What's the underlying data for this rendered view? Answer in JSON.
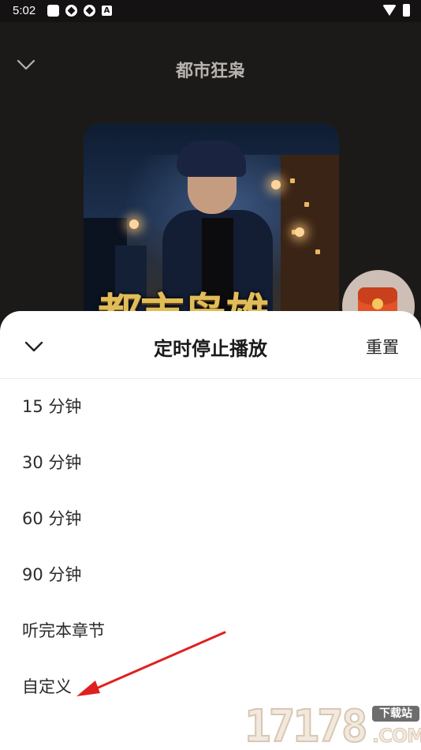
{
  "status_bar": {
    "time": "5:02",
    "left_icons": [
      "app-square-icon",
      "aperture-icon",
      "aperture-icon",
      "a-badge-icon"
    ],
    "right_icons": [
      "wifi-icon",
      "battery-icon"
    ],
    "a_badge": "A"
  },
  "player": {
    "title": "都市狂枭",
    "cover_title": "都市枭雄",
    "collapse_icon": "chevron-down-icon"
  },
  "floating_gift": {
    "icon": "red-envelope-icon"
  },
  "sheet": {
    "title": "定时停止播放",
    "reset_label": "重置",
    "collapse_icon": "chevron-down-icon",
    "options": [
      {
        "label": "15 分钟"
      },
      {
        "label": "30 分钟"
      },
      {
        "label": "60 分钟"
      },
      {
        "label": "90 分钟"
      },
      {
        "label": "听完本章节"
      },
      {
        "label": "自定义"
      }
    ]
  },
  "annotation": {
    "color": "#e0201e",
    "points_to": "自定义"
  },
  "watermark": {
    "number": "17178",
    "badge": "下载站",
    "suffix": ".COM"
  },
  "colors": {
    "background": "#1c1a19",
    "sheet": "#ffffff",
    "title_text": "#b7b3ae",
    "cover_title": "#e1bd59"
  }
}
